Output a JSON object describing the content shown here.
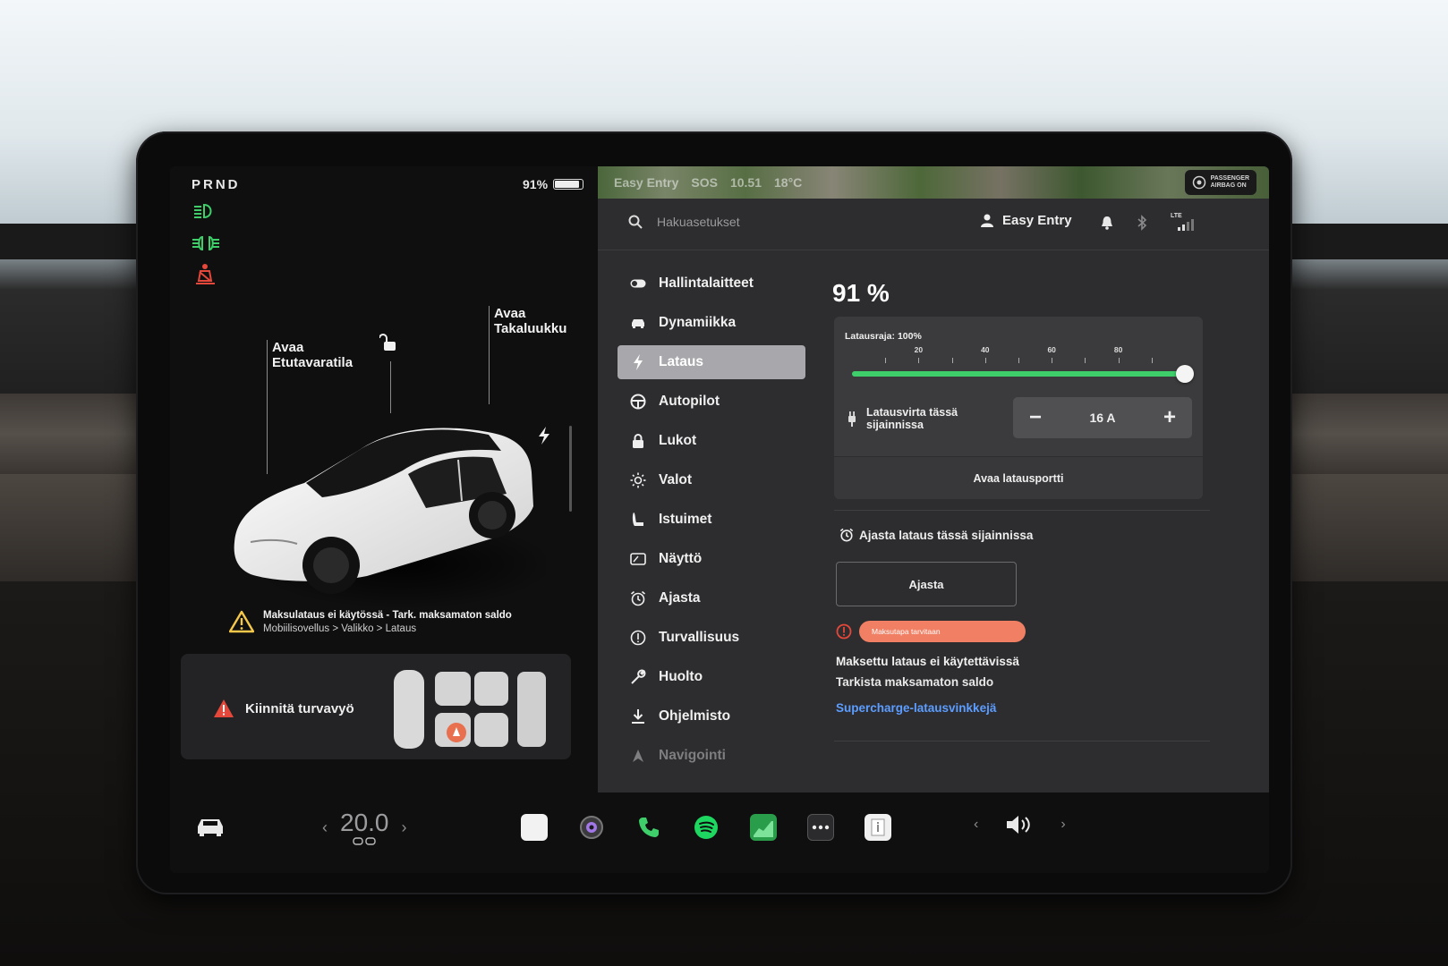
{
  "status": {
    "gear": "PRND",
    "battery_pct": "91%",
    "battery_level": 0.91
  },
  "car": {
    "open_frunk": "Avaa\nEtutavaratila",
    "open_trunk": "Avaa\nTakaluukku",
    "warning_line1": "Maksulataus ei käytössä - Tark. maksamaton saldo",
    "warning_line2": "Mobiilisovellus > Valikko > Lataus",
    "seatbelt_alert": "Kiinnitä turvavyö"
  },
  "mapbar": {
    "profile": "Easy Entry",
    "sos": "SOS",
    "time": "10.51",
    "temp": "18°C",
    "airbag_line1": "PASSENGER",
    "airbag_line2": "AIRBAG ON"
  },
  "topbar": {
    "search_placeholder": "Hakuasetukset",
    "profile_name": "Easy Entry",
    "lte": "LTE"
  },
  "menu": [
    {
      "label": "Hallintalaitteet",
      "icon": "toggle-icon"
    },
    {
      "label": "Dynamiikka",
      "icon": "car-icon"
    },
    {
      "label": "Lataus",
      "icon": "bolt-icon",
      "active": true
    },
    {
      "label": "Autopilot",
      "icon": "steering-wheel-icon"
    },
    {
      "label": "Lukot",
      "icon": "lock-icon"
    },
    {
      "label": "Valot",
      "icon": "sun-icon"
    },
    {
      "label": "Istuimet",
      "icon": "seat-icon"
    },
    {
      "label": "Näyttö",
      "icon": "display-icon"
    },
    {
      "label": "Ajasta",
      "icon": "alarm-clock-icon"
    },
    {
      "label": "Turvallisuus",
      "icon": "info-circle-icon"
    },
    {
      "label": "Huolto",
      "icon": "wrench-icon"
    },
    {
      "label": "Ohjelmisto",
      "icon": "download-icon"
    },
    {
      "label": "Navigointi",
      "icon": "navigation-icon"
    }
  ],
  "charging": {
    "percent": "91 %",
    "limit_label": "Latausraja: 100%",
    "limit_value": 1.0,
    "ticks": [
      "20",
      "40",
      "60",
      "80"
    ],
    "current_label": "Latausvirta tässä\nsijainnissa",
    "current_value": "16 A",
    "minus": "−",
    "plus": "+",
    "open_port": "Avaa latausportti",
    "schedule_title": "Ajasta lataus tässä sijainnissa",
    "schedule_button": "Ajasta",
    "payment_pill": "Maksutapa tarvitaan",
    "paid_unavailable": "Maksettu lataus ei käytettävissä",
    "check_balance": "Tarkista maksamaton saldo",
    "supercharge_tips": "Supercharge-latausvinkkejä"
  },
  "dock": {
    "temperature": "20.0",
    "left_chevron": "‹",
    "right_chevron": "›"
  },
  "colors": {
    "accent_green": "#3ecf6b",
    "link_blue": "#5c9dff",
    "warning_red": "#e5483a",
    "payment_orange": "#f07f63"
  }
}
